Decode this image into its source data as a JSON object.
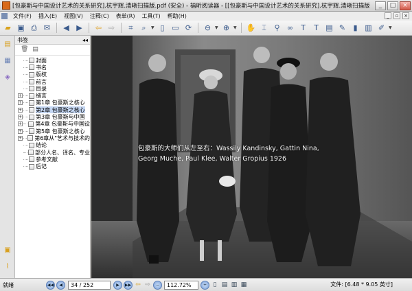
{
  "window": {
    "title": "[包豪斯与中国设计艺术的关系研究].杭宇辉.清晰扫描版.pdf (安全) - 福昕阅读器 - [[包豪斯与中国设计艺术的关系研究].杭宇辉.清晰扫描版.pdf (安全..."
  },
  "menu": {
    "items": [
      "文件(F)",
      "插入(E)",
      "视图(V)",
      "注释(C)",
      "表单(R)",
      "工具(T)",
      "帮助(H)"
    ]
  },
  "sidebar": {
    "header": "书签",
    "bookmarks": [
      {
        "label": "封面",
        "expandable": false
      },
      {
        "label": "书名",
        "expandable": false
      },
      {
        "label": "版权",
        "expandable": false
      },
      {
        "label": "前言",
        "expandable": false
      },
      {
        "label": "目录",
        "expandable": false
      },
      {
        "label": "绪言",
        "expandable": true
      },
      {
        "label": "第1章  包豪斯之核心",
        "expandable": true
      },
      {
        "label": "第2章  包豪斯之核心",
        "expandable": true
      },
      {
        "label": "第3章  包豪斯与中国",
        "expandable": true
      },
      {
        "label": "第4章  包豪斯与中国设",
        "expandable": true
      },
      {
        "label": "第5章  包豪斯之核心",
        "expandable": true
      },
      {
        "label": "第6章从\"艺术与技术的",
        "expandable": true
      },
      {
        "label": "结论",
        "expandable": false
      },
      {
        "label": "部分人名、译名、专业",
        "expandable": false
      },
      {
        "label": "参考文献",
        "expandable": false
      },
      {
        "label": "后记",
        "expandable": false
      }
    ],
    "selected_index": 7
  },
  "document": {
    "caption_line1": "包豪斯的大师们从左至右：Wassily Kandinsky, Gattin Nina,",
    "caption_line2": "Georg Muche, Paul Klee, Walter Gropius    1926"
  },
  "status": {
    "ready": "就绪",
    "page": "34 / 252",
    "zoom": "112.72%",
    "file_size": "文件: [6.48 * 9.05 英寸]"
  }
}
